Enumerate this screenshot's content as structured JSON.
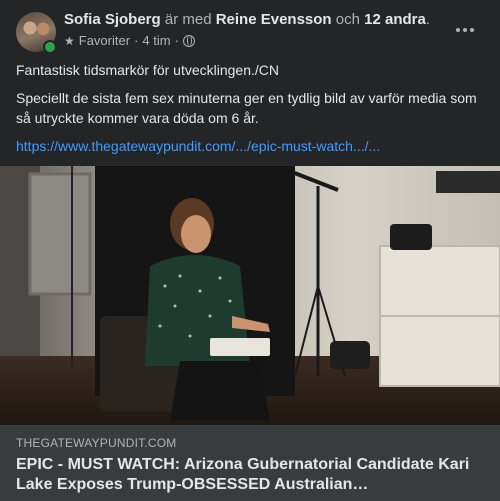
{
  "post": {
    "author": "Sofia Sjoberg",
    "with_text": "är med",
    "tagged": "Reine Evensson",
    "and_text": "och",
    "others": "12 andra",
    "title_end": ".",
    "audience": "Favoriter",
    "separator": "·",
    "time": "4 tim",
    "separator2": "·",
    "text_line1": "Fantastisk tidsmarkör för utvecklingen./CN",
    "text_line2": "Speciellt de sista fem sex minuterna ger en tydlig bild av varför media som så utryckte kommer vara döda om 6 år.",
    "link": "https://www.thegatewaypundit.com/.../epic-must-watch.../..."
  },
  "card": {
    "domain": "THEGATEWAYPUNDIT.COM",
    "headline": "EPIC - MUST WATCH: Arizona Gubernatorial Candidate Kari Lake Exposes Trump-OBSESSED Australian…"
  },
  "icons": {
    "avatar": "profile-photo",
    "audience": "star-icon",
    "privacy": "globe-icon",
    "more": "more-options-icon"
  },
  "colors": {
    "background": "#242526",
    "card_footer": "#3a3b3c",
    "link": "#4599ff",
    "online": "#31a24c"
  }
}
